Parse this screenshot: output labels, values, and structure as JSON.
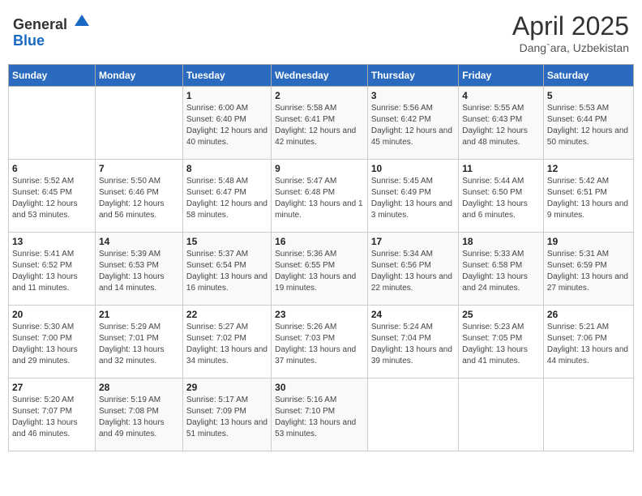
{
  "header": {
    "logo_general": "General",
    "logo_blue": "Blue",
    "month_title": "April 2025",
    "location": "Dang`ara, Uzbekistan"
  },
  "days_of_week": [
    "Sunday",
    "Monday",
    "Tuesday",
    "Wednesday",
    "Thursday",
    "Friday",
    "Saturday"
  ],
  "weeks": [
    [
      {
        "day": "",
        "sunrise": "",
        "sunset": "",
        "daylight": ""
      },
      {
        "day": "",
        "sunrise": "",
        "sunset": "",
        "daylight": ""
      },
      {
        "day": "1",
        "sunrise": "Sunrise: 6:00 AM",
        "sunset": "Sunset: 6:40 PM",
        "daylight": "Daylight: 12 hours and 40 minutes."
      },
      {
        "day": "2",
        "sunrise": "Sunrise: 5:58 AM",
        "sunset": "Sunset: 6:41 PM",
        "daylight": "Daylight: 12 hours and 42 minutes."
      },
      {
        "day": "3",
        "sunrise": "Sunrise: 5:56 AM",
        "sunset": "Sunset: 6:42 PM",
        "daylight": "Daylight: 12 hours and 45 minutes."
      },
      {
        "day": "4",
        "sunrise": "Sunrise: 5:55 AM",
        "sunset": "Sunset: 6:43 PM",
        "daylight": "Daylight: 12 hours and 48 minutes."
      },
      {
        "day": "5",
        "sunrise": "Sunrise: 5:53 AM",
        "sunset": "Sunset: 6:44 PM",
        "daylight": "Daylight: 12 hours and 50 minutes."
      }
    ],
    [
      {
        "day": "6",
        "sunrise": "Sunrise: 5:52 AM",
        "sunset": "Sunset: 6:45 PM",
        "daylight": "Daylight: 12 hours and 53 minutes."
      },
      {
        "day": "7",
        "sunrise": "Sunrise: 5:50 AM",
        "sunset": "Sunset: 6:46 PM",
        "daylight": "Daylight: 12 hours and 56 minutes."
      },
      {
        "day": "8",
        "sunrise": "Sunrise: 5:48 AM",
        "sunset": "Sunset: 6:47 PM",
        "daylight": "Daylight: 12 hours and 58 minutes."
      },
      {
        "day": "9",
        "sunrise": "Sunrise: 5:47 AM",
        "sunset": "Sunset: 6:48 PM",
        "daylight": "Daylight: 13 hours and 1 minute."
      },
      {
        "day": "10",
        "sunrise": "Sunrise: 5:45 AM",
        "sunset": "Sunset: 6:49 PM",
        "daylight": "Daylight: 13 hours and 3 minutes."
      },
      {
        "day": "11",
        "sunrise": "Sunrise: 5:44 AM",
        "sunset": "Sunset: 6:50 PM",
        "daylight": "Daylight: 13 hours and 6 minutes."
      },
      {
        "day": "12",
        "sunrise": "Sunrise: 5:42 AM",
        "sunset": "Sunset: 6:51 PM",
        "daylight": "Daylight: 13 hours and 9 minutes."
      }
    ],
    [
      {
        "day": "13",
        "sunrise": "Sunrise: 5:41 AM",
        "sunset": "Sunset: 6:52 PM",
        "daylight": "Daylight: 13 hours and 11 minutes."
      },
      {
        "day": "14",
        "sunrise": "Sunrise: 5:39 AM",
        "sunset": "Sunset: 6:53 PM",
        "daylight": "Daylight: 13 hours and 14 minutes."
      },
      {
        "day": "15",
        "sunrise": "Sunrise: 5:37 AM",
        "sunset": "Sunset: 6:54 PM",
        "daylight": "Daylight: 13 hours and 16 minutes."
      },
      {
        "day": "16",
        "sunrise": "Sunrise: 5:36 AM",
        "sunset": "Sunset: 6:55 PM",
        "daylight": "Daylight: 13 hours and 19 minutes."
      },
      {
        "day": "17",
        "sunrise": "Sunrise: 5:34 AM",
        "sunset": "Sunset: 6:56 PM",
        "daylight": "Daylight: 13 hours and 22 minutes."
      },
      {
        "day": "18",
        "sunrise": "Sunrise: 5:33 AM",
        "sunset": "Sunset: 6:58 PM",
        "daylight": "Daylight: 13 hours and 24 minutes."
      },
      {
        "day": "19",
        "sunrise": "Sunrise: 5:31 AM",
        "sunset": "Sunset: 6:59 PM",
        "daylight": "Daylight: 13 hours and 27 minutes."
      }
    ],
    [
      {
        "day": "20",
        "sunrise": "Sunrise: 5:30 AM",
        "sunset": "Sunset: 7:00 PM",
        "daylight": "Daylight: 13 hours and 29 minutes."
      },
      {
        "day": "21",
        "sunrise": "Sunrise: 5:29 AM",
        "sunset": "Sunset: 7:01 PM",
        "daylight": "Daylight: 13 hours and 32 minutes."
      },
      {
        "day": "22",
        "sunrise": "Sunrise: 5:27 AM",
        "sunset": "Sunset: 7:02 PM",
        "daylight": "Daylight: 13 hours and 34 minutes."
      },
      {
        "day": "23",
        "sunrise": "Sunrise: 5:26 AM",
        "sunset": "Sunset: 7:03 PM",
        "daylight": "Daylight: 13 hours and 37 minutes."
      },
      {
        "day": "24",
        "sunrise": "Sunrise: 5:24 AM",
        "sunset": "Sunset: 7:04 PM",
        "daylight": "Daylight: 13 hours and 39 minutes."
      },
      {
        "day": "25",
        "sunrise": "Sunrise: 5:23 AM",
        "sunset": "Sunset: 7:05 PM",
        "daylight": "Daylight: 13 hours and 41 minutes."
      },
      {
        "day": "26",
        "sunrise": "Sunrise: 5:21 AM",
        "sunset": "Sunset: 7:06 PM",
        "daylight": "Daylight: 13 hours and 44 minutes."
      }
    ],
    [
      {
        "day": "27",
        "sunrise": "Sunrise: 5:20 AM",
        "sunset": "Sunset: 7:07 PM",
        "daylight": "Daylight: 13 hours and 46 minutes."
      },
      {
        "day": "28",
        "sunrise": "Sunrise: 5:19 AM",
        "sunset": "Sunset: 7:08 PM",
        "daylight": "Daylight: 13 hours and 49 minutes."
      },
      {
        "day": "29",
        "sunrise": "Sunrise: 5:17 AM",
        "sunset": "Sunset: 7:09 PM",
        "daylight": "Daylight: 13 hours and 51 minutes."
      },
      {
        "day": "30",
        "sunrise": "Sunrise: 5:16 AM",
        "sunset": "Sunset: 7:10 PM",
        "daylight": "Daylight: 13 hours and 53 minutes."
      },
      {
        "day": "",
        "sunrise": "",
        "sunset": "",
        "daylight": ""
      },
      {
        "day": "",
        "sunrise": "",
        "sunset": "",
        "daylight": ""
      },
      {
        "day": "",
        "sunrise": "",
        "sunset": "",
        "daylight": ""
      }
    ]
  ]
}
